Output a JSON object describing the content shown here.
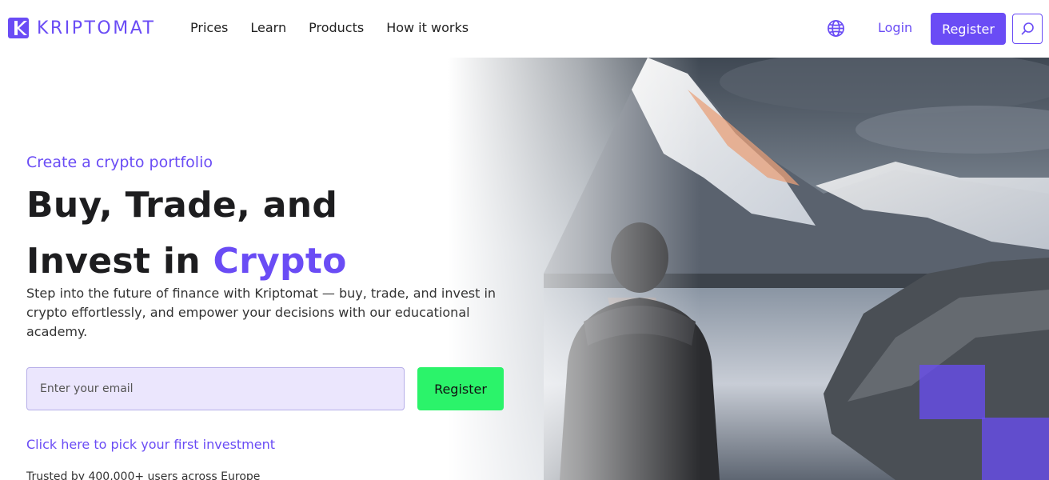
{
  "brand": {
    "name": "KRIPTOMAT",
    "color": "#6a4cf5"
  },
  "nav": {
    "items": [
      "Prices",
      "Learn",
      "Products",
      "How it works"
    ]
  },
  "header": {
    "language_icon": "globe-icon",
    "login_label": "Login",
    "register_label": "Register",
    "search_icon": "search-icon"
  },
  "hero": {
    "eyebrow": "Create a crypto portfolio",
    "headline_line1": "Buy, Trade, and",
    "headline_line2_prefix": "Invest in ",
    "headline_line2_accent": "Crypto",
    "description": "Step into the future of finance with Kriptomat — buy, trade, and invest in crypto effortlessly, and empower your decisions with our educational academy.",
    "email_placeholder": "Enter your email",
    "register_label": "Register",
    "pick_link": "Click here to pick your first investment",
    "trusted": "Trusted by 400,000+ users across Europe"
  },
  "colors": {
    "accent": "#6a4cf5",
    "cta_green": "#2bf36a",
    "input_bg": "#ebe6fd"
  }
}
